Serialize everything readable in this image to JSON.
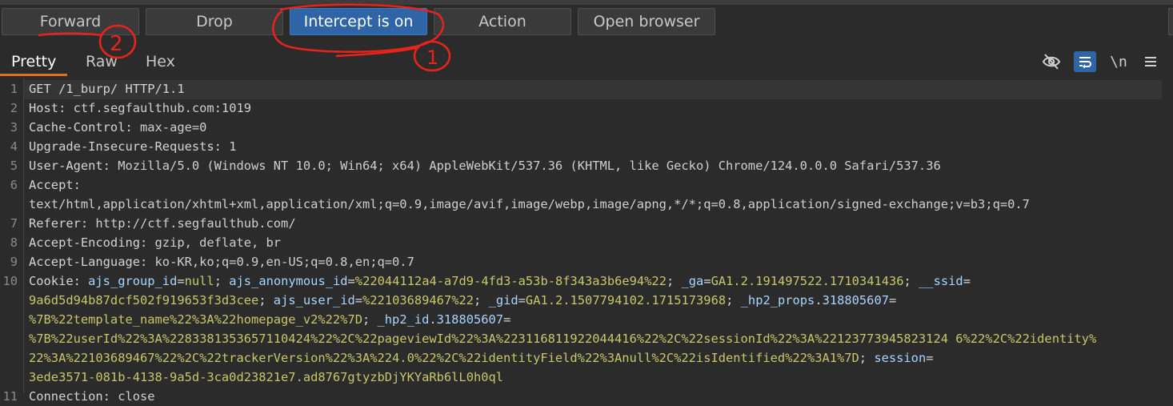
{
  "toolbar": {
    "forward": "Forward",
    "drop": "Drop",
    "intercept": "Intercept is on",
    "action": "Action",
    "open_browser": "Open browser"
  },
  "tabs": {
    "pretty": "Pretty",
    "raw": "Raw",
    "hex": "Hex",
    "newline_toggle": "\\n"
  },
  "annotations": {
    "one": "1",
    "two": "2"
  },
  "lines": [
    {
      "n": "1",
      "parts": [
        [
          "k",
          "GET /1_burp/ HTTP/1.1"
        ]
      ]
    },
    {
      "n": "2",
      "parts": [
        [
          "k",
          "Host: "
        ],
        [
          "v",
          "ctf.segfaulthub.com:1019"
        ]
      ]
    },
    {
      "n": "3",
      "parts": [
        [
          "k",
          "Cache-Control: "
        ],
        [
          "v",
          "max-age=0"
        ]
      ]
    },
    {
      "n": "4",
      "parts": [
        [
          "k",
          "Upgrade-Insecure-Requests: "
        ],
        [
          "v",
          "1"
        ]
      ]
    },
    {
      "n": "5",
      "parts": [
        [
          "k",
          "User-Agent: "
        ],
        [
          "v",
          "Mozilla/5.0 (Windows NT 10.0; Win64; x64) AppleWebKit/537.36 (KHTML, like Gecko) Chrome/124.0.0.0 Safari/537.36"
        ]
      ]
    },
    {
      "n": "6",
      "parts": [
        [
          "k",
          "Accept:"
        ]
      ]
    },
    {
      "n": "",
      "parts": [
        [
          "v",
          "text/html,application/xhtml+xml,application/xml;q=0.9,image/avif,image/webp,image/apng,*/*;q=0.8,application/signed-exchange;v=b3;q=0.7"
        ]
      ]
    },
    {
      "n": "7",
      "parts": [
        [
          "k",
          "Referer: "
        ],
        [
          "v",
          "http://ctf.segfaulthub.com/"
        ]
      ]
    },
    {
      "n": "8",
      "parts": [
        [
          "k",
          "Accept-Encoding: "
        ],
        [
          "v",
          "gzip, deflate, br"
        ]
      ]
    },
    {
      "n": "9",
      "parts": [
        [
          "k",
          "Accept-Language: "
        ],
        [
          "v",
          "ko-KR,ko;q=0.9,en-US;q=0.8,en;q=0.7"
        ]
      ]
    },
    {
      "n": "10",
      "parts": [
        [
          "k",
          "Cookie: "
        ],
        [
          "ck",
          "ajs_group_id"
        ],
        [
          "k",
          "="
        ],
        [
          "cv",
          "null"
        ],
        [
          "k",
          "; "
        ],
        [
          "ck",
          "ajs_anonymous_id"
        ],
        [
          "k",
          "="
        ],
        [
          "cv",
          "%22044112a4-a7d9-4fd3-a53b-8f343a3b6e94%22"
        ],
        [
          "k",
          "; "
        ],
        [
          "ck",
          "_ga"
        ],
        [
          "k",
          "="
        ],
        [
          "cv",
          "GA1.2.191497522.1710341436"
        ],
        [
          "k",
          "; "
        ],
        [
          "ck",
          "__ssid"
        ],
        [
          "k",
          "="
        ]
      ]
    },
    {
      "n": "",
      "parts": [
        [
          "cv",
          "9a6d5d94b87dcf502f919653f3d3cee"
        ],
        [
          "k",
          "; "
        ],
        [
          "ck",
          "ajs_user_id"
        ],
        [
          "k",
          "="
        ],
        [
          "cv",
          "%22103689467%22"
        ],
        [
          "k",
          "; "
        ],
        [
          "ck",
          "_gid"
        ],
        [
          "k",
          "="
        ],
        [
          "cv",
          "GA1.2.1507794102.1715173968"
        ],
        [
          "k",
          "; "
        ],
        [
          "ck",
          "_hp2_props.318805607"
        ],
        [
          "k",
          "="
        ]
      ]
    },
    {
      "n": "",
      "parts": [
        [
          "cv",
          "%7B%22template_name%22%3A%22homepage_v2%22%7D"
        ],
        [
          "k",
          "; "
        ],
        [
          "ck",
          "_hp2_id.318805607"
        ],
        [
          "k",
          "="
        ]
      ]
    },
    {
      "n": "",
      "parts": [
        [
          "cv",
          "%7B%22userId%22%3A%2283381353657110424%22%2C%22pageviewId%22%3A%223116811922044416%22%2C%22sessionId%22%3A%22123773945823124 6%22%2C%22identity%"
        ]
      ]
    },
    {
      "n": "",
      "parts": [
        [
          "cv",
          "22%3A%22103689467%22%2C%22trackerVersion%22%3A%224.0%22%2C%22identityField%22%3Anull%2C%22isIdentified%22%3A1%7D"
        ],
        [
          "k",
          "; "
        ],
        [
          "ck",
          "session"
        ],
        [
          "k",
          "="
        ]
      ]
    },
    {
      "n": "",
      "parts": [
        [
          "cv",
          "3ede3571-081b-4138-9a5d-3ca0d23821e7.ad8767gtyzbDjYKYaRb6lL0h0ql"
        ]
      ]
    },
    {
      "n": "11",
      "parts": [
        [
          "k",
          "Connection: "
        ],
        [
          "v",
          "close"
        ]
      ]
    }
  ]
}
